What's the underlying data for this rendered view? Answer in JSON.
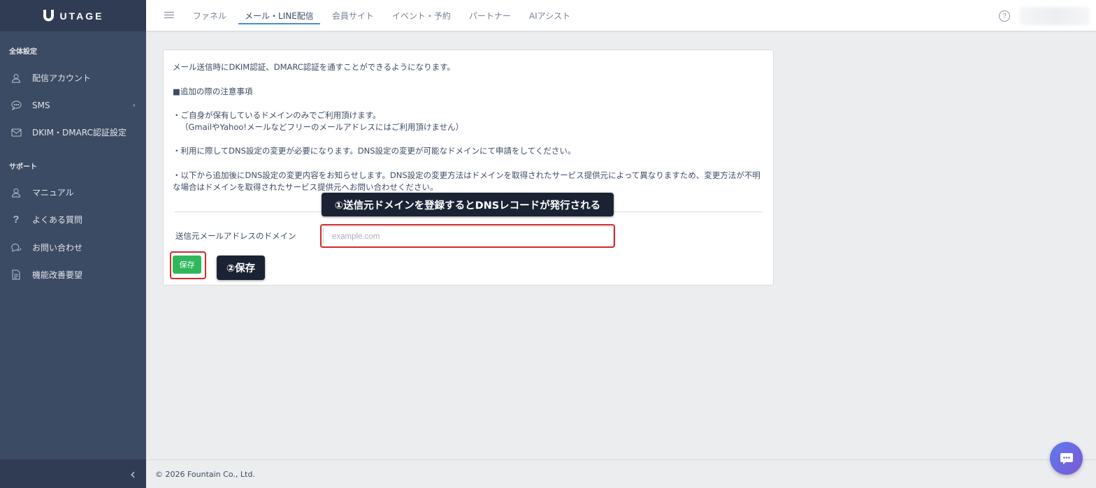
{
  "brand": {
    "name": "UTAGE"
  },
  "sidebar": {
    "sections": [
      {
        "title": "全体設定",
        "items": [
          {
            "label": "配信アカウント",
            "icon": "user-icon"
          },
          {
            "label": "SMS",
            "icon": "sms-chat-icon",
            "has_submenu": true
          },
          {
            "label": "DKIM・DMARC認証設定",
            "icon": "envelope-icon"
          }
        ]
      },
      {
        "title": "サポート",
        "items": [
          {
            "label": "マニュアル",
            "icon": "user-icon"
          },
          {
            "label": "よくある質問",
            "icon": "question-icon"
          },
          {
            "label": "お問い合わせ",
            "icon": "chat-bubbles-icon"
          },
          {
            "label": "機能改善要望",
            "icon": "document-icon"
          }
        ]
      }
    ],
    "chevron": "‹",
    "collapse_icon": "‹"
  },
  "header": {
    "tabs": [
      {
        "label": "ファネル",
        "active": false
      },
      {
        "label": "メール・LINE配信",
        "active": true
      },
      {
        "label": "会員サイト",
        "active": false
      },
      {
        "label": "イベント・予約",
        "active": false
      },
      {
        "label": "パートナー",
        "active": false
      },
      {
        "label": "AIアシスト",
        "active": false
      }
    ],
    "help_glyph": "?"
  },
  "main": {
    "intro": "メール送信時にDKIM認証、DMARC認証を通すことができるようになります。",
    "notes_heading": "■追加の際の注意事項",
    "note1_line1": "・ご自身が保有しているドメインのみでご利用頂けます。",
    "note1_line2": "（GmailやYahoo!メールなどフリーのメールアドレスにはご利用頂けません）",
    "note2": "・利用に際してDNS設定の変更が必要になります。DNS設定の変更が可能なドメインにて申請をしてください。",
    "note3": "・以下から追加後にDNS設定の変更内容をお知らせします。DNS設定の変更方法はドメインを取得されたサービス提供元によって異なりますため、変更方法が不明な場合はドメインを取得されたサービス提供元へお問い合わせください。",
    "form": {
      "domain_label": "送信元メールアドレスのドメイン",
      "domain_placeholder": "example.com",
      "domain_value": "",
      "save_label": "保存"
    }
  },
  "annotations": {
    "callout_1": "①送信元ドメインを登録するとDNSレコードが発行される",
    "callout_2": "②保存",
    "highlight_color": "#d32a2a"
  },
  "footer": {
    "copyright": "© 2026 Fountain Co., Ltd."
  },
  "colors": {
    "sidebar_bg": "#3c4b64",
    "brand_bg": "#303c54",
    "page_bg": "#ebedef",
    "save_button": "#2eb85c",
    "active_tab_underline": "#4b8ad6"
  }
}
